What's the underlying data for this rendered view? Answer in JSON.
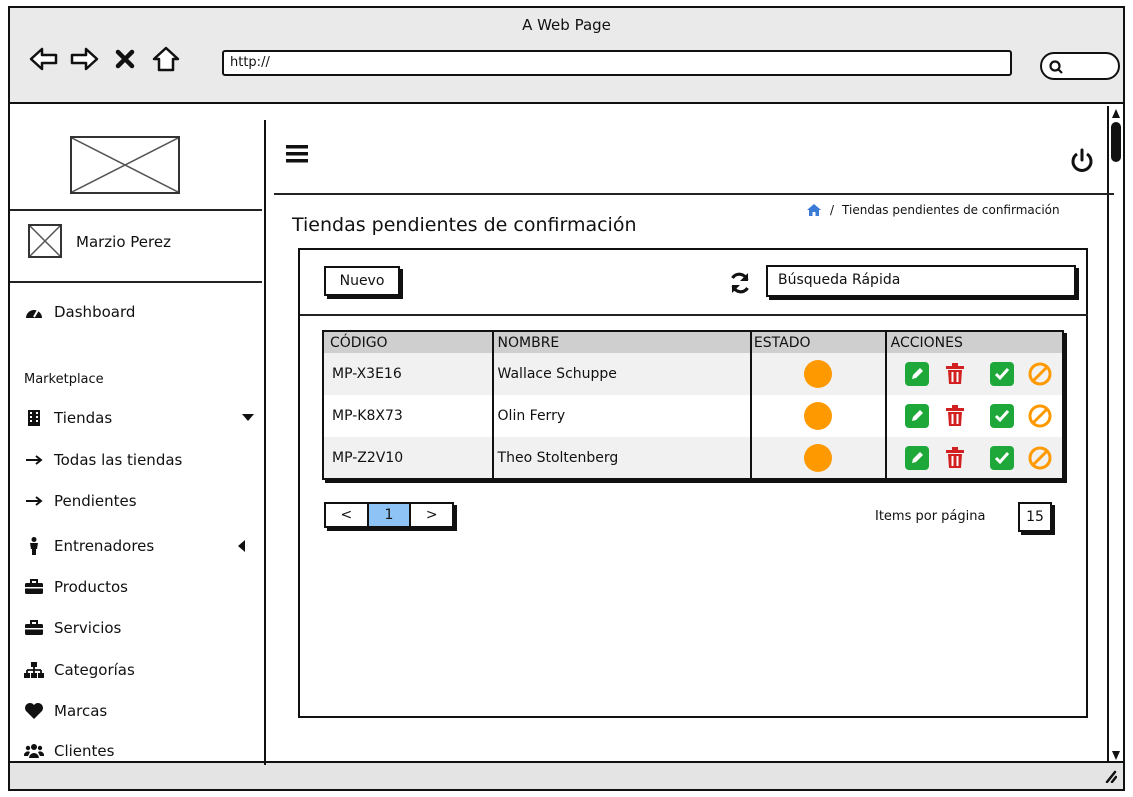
{
  "browser": {
    "title": "A Web Page",
    "url": "http://"
  },
  "sidebar": {
    "user_name": "Marzio Perez",
    "dashboard": "Dashboard",
    "section": "Marketplace",
    "items": [
      {
        "label": "Tiendas",
        "icon": "building-icon"
      },
      {
        "label": "Todas las tiendas",
        "icon": "arrow-right-icon"
      },
      {
        "label": "Pendientes",
        "icon": "arrow-right-icon"
      },
      {
        "label": "Entrenadores",
        "icon": "person-icon"
      },
      {
        "label": "Productos",
        "icon": "briefcase-icon"
      },
      {
        "label": "Servicios",
        "icon": "briefcase-icon"
      },
      {
        "label": "Categorías",
        "icon": "sitemap-icon"
      },
      {
        "label": "Marcas",
        "icon": "heart-icon"
      },
      {
        "label": "Clientes",
        "icon": "users-icon"
      }
    ]
  },
  "header": {
    "breadcrumb_sep": "/",
    "breadcrumb_current": "Tiendas pendientes de confirmación",
    "page_title": "Tiendas pendientes de confirmación"
  },
  "toolbar": {
    "new_label": "Nuevo",
    "search_placeholder": "Búsqueda Rápida"
  },
  "table": {
    "columns": [
      "CÓDIGO",
      "NOMBRE",
      "ESTADO",
      "ACCIONES"
    ],
    "rows": [
      {
        "code": "MP-X3E16",
        "name": "Wallace Schuppe"
      },
      {
        "code": "MP-K8X73",
        "name": "Olin Ferry"
      },
      {
        "code": "MP-Z2V10",
        "name": "Theo Stoltenberg"
      }
    ],
    "status_color": "#ff9900"
  },
  "pagination": {
    "prev": "<",
    "page": "1",
    "next": ">",
    "items_label": "Items por página",
    "items_value": "15"
  },
  "colors": {
    "edit": "#1fa83a",
    "delete": "#d21f1f",
    "approve": "#1fa83a",
    "reject": "#ff9900",
    "home": "#3a7bd5",
    "page_active": "#8ec3f5"
  }
}
